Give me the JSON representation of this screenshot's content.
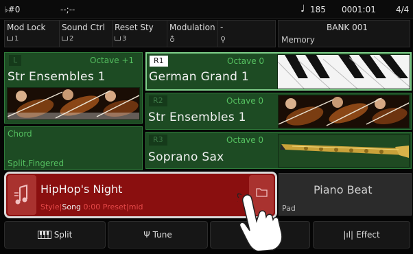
{
  "status_bar": {
    "sharp_flat": "♭#0",
    "chord_display": "--;--",
    "tempo_icon": "quarter-note-icon",
    "tempo": "185",
    "position": "0001:01",
    "time_signature": "4/4"
  },
  "controls": [
    {
      "label": "Mod Lock",
      "value": "1"
    },
    {
      "label": "Sound Ctrl",
      "value": "2"
    },
    {
      "label": "Reset Sty",
      "value": "3"
    },
    {
      "label": "Modulation",
      "value": ""
    },
    {
      "label": "-",
      "value": ""
    }
  ],
  "bank": {
    "title": "BANK 001",
    "subtitle": "Memory"
  },
  "voices": {
    "l": {
      "tag": "L",
      "octave": "Octave +1",
      "name": "Str Ensembles 1"
    },
    "r1": {
      "tag": "R1",
      "octave": "Octave 0",
      "name": "German Grand 1"
    },
    "r2": {
      "tag": "R2",
      "octave": "Octave 0",
      "name": "Str Ensembles 1"
    },
    "r3": {
      "tag": "R3",
      "octave": "Octave 0",
      "name": "Soprano Sax"
    }
  },
  "chord_panel": {
    "title": "Chord",
    "mode": "Split,Fingered"
  },
  "song": {
    "name": "HipHop's Night",
    "style_label": "Style",
    "song_label": "Song",
    "time": "0:00",
    "preset": "Preset",
    "mid": "mid"
  },
  "pad": {
    "name": "Piano Beat",
    "label": "Pad"
  },
  "bottom_buttons": {
    "split": "Split",
    "tune": "Tune",
    "effect": "Effect"
  },
  "colors": {
    "voice_green": "#1d4b23",
    "octave_green": "#55c060",
    "song_red": "#8a0f0f",
    "song_accent": "#e84a4a"
  }
}
